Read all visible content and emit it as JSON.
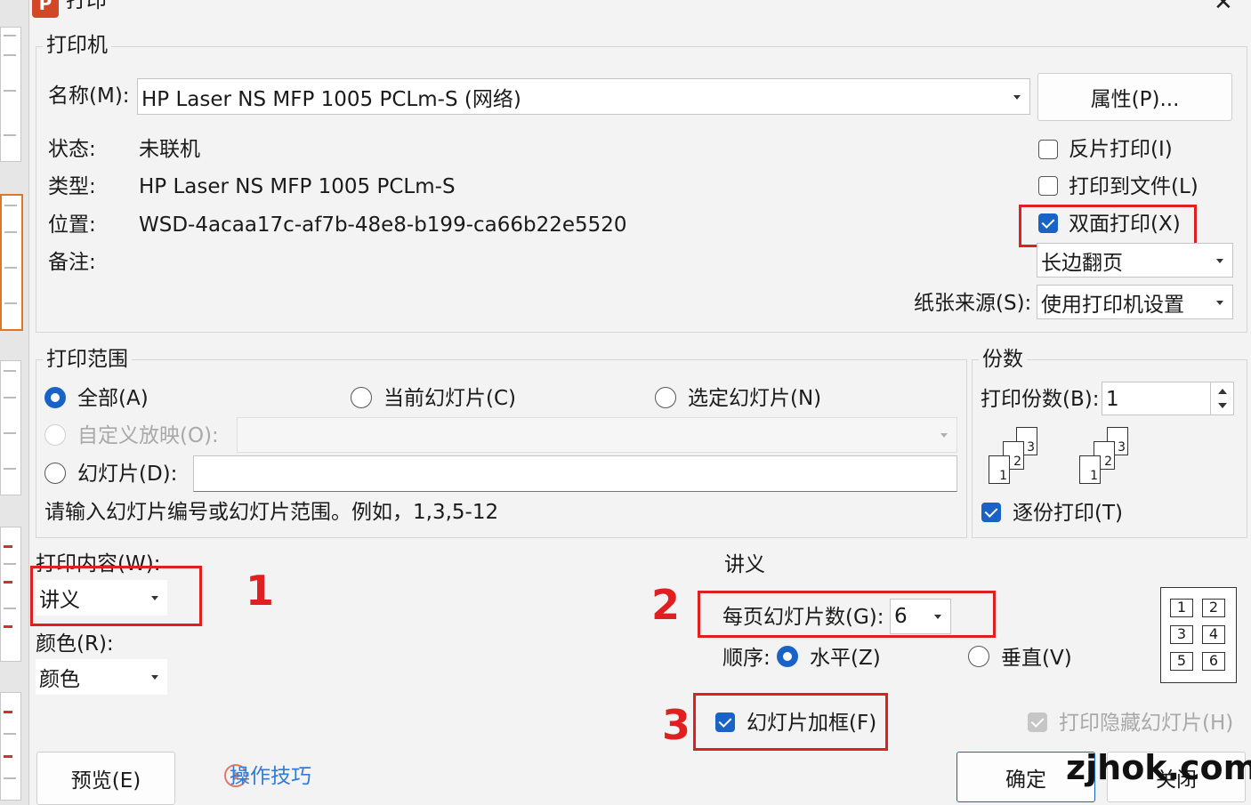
{
  "window": {
    "title": "打印",
    "app_icon_letter": "P",
    "close_symbol": "✕"
  },
  "printer": {
    "group_title": "打印机",
    "name_label": "名称(M):",
    "name_value": "HP Laser NS MFP 1005 PCLm-S (网络)",
    "properties_button": "属性(P)...",
    "status_label": "状态:",
    "status_value": "未联机",
    "type_label": "类型:",
    "type_value": "HP Laser NS MFP 1005 PCLm-S",
    "location_label": "位置:",
    "location_value": "WSD-4acaa17c-af7b-48e8-b199-ca66b22e5520",
    "comment_label": "备注:",
    "reverse_print": {
      "label": "反片打印(I)",
      "checked": false
    },
    "print_to_file": {
      "label": "打印到文件(L)",
      "checked": false
    },
    "duplex": {
      "label": "双面打印(X)",
      "checked": true
    },
    "duplex_mode": "长边翻页",
    "paper_source_label": "纸张来源(S):",
    "paper_source_value": "使用打印机设置"
  },
  "range": {
    "group_title": "打印范围",
    "all": "全部(A)",
    "current": "当前幻灯片(C)",
    "selected": "选定幻灯片(N)",
    "custom_show": "自定义放映(O):",
    "slides": "幻灯片(D):",
    "hint": "请输入幻灯片编号或幻灯片范围。例如，1,3,5-12"
  },
  "copies": {
    "group_title": "份数",
    "count_label": "打印份数(B):",
    "count_value": "1",
    "collate": {
      "label": "逐份打印(T)",
      "checked": true
    },
    "page_numbers": [
      "1",
      "2",
      "3"
    ]
  },
  "content": {
    "label": "打印内容(W):",
    "value": "讲义",
    "color_label": "颜色(R):",
    "color_value": "颜色"
  },
  "handout": {
    "group_title": "讲义",
    "per_page_label": "每页幻灯片数(G):",
    "per_page_value": "6",
    "order_label": "顺序:",
    "horizontal": "水平(Z)",
    "vertical": "垂直(V)",
    "layout_numbers": [
      "1",
      "2",
      "3",
      "4",
      "5",
      "6"
    ]
  },
  "frame_slides": {
    "label": "幻灯片加框(F)",
    "checked": true
  },
  "print_hidden": {
    "label": "打印隐藏幻灯片(H)",
    "checked": true,
    "disabled": true
  },
  "buttons": {
    "preview": "预览(E)",
    "tips": "操作技巧",
    "ok": "确定",
    "close": "关闭"
  },
  "annotations": [
    "1",
    "2",
    "3"
  ],
  "watermark": "zjhok.com",
  "colors": {
    "accent": "#1a63c6",
    "annotation_red": "#e02020",
    "link": "#2f7bd6"
  }
}
